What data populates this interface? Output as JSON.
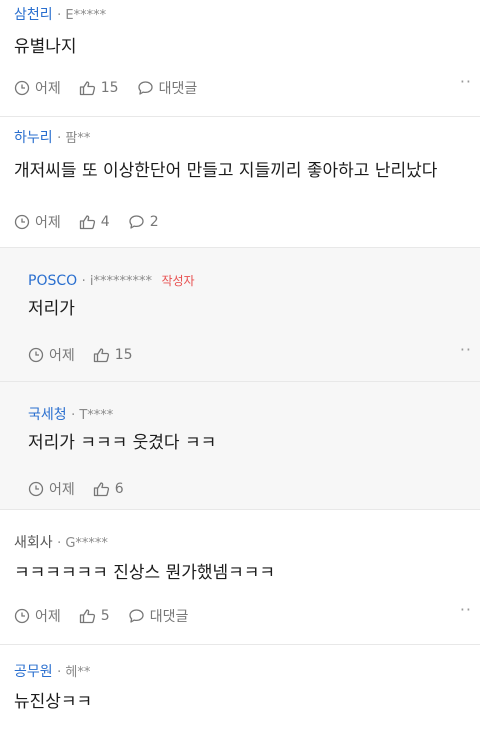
{
  "comments": [
    {
      "nick": "삼천리",
      "user": "E*****",
      "text": "유별나지",
      "time": "어제",
      "likes": "15",
      "reply": "대댓글"
    },
    {
      "nick": "하누리",
      "user": "팜**",
      "text": "개저씨들 또 이상한단어 만들고 지들끼리 좋아하고 난리났다",
      "time": "어제",
      "likes": "4",
      "reply": "2"
    },
    {
      "nick": "POSCO",
      "user": "i*********",
      "badge": "작성자",
      "text": "저리가",
      "time": "어제",
      "likes": "15"
    },
    {
      "nick": "국세청",
      "user": "T****",
      "text": "저리가 ㅋㅋㅋ 웃겼다 ㅋㅋ",
      "time": "어제",
      "likes": "6"
    },
    {
      "nick": "새회사",
      "user": "G*****",
      "text": "ㅋㅋㅋㅋㅋㅋ 진상스 뭔가했넴ㅋㅋㅋ",
      "time": "어제",
      "likes": "5",
      "reply": "대댓글"
    },
    {
      "nick": "공무원",
      "user": "헤**",
      "text": "뉴진상ㅋㅋ"
    }
  ],
  "ui": {
    "more": "··"
  }
}
